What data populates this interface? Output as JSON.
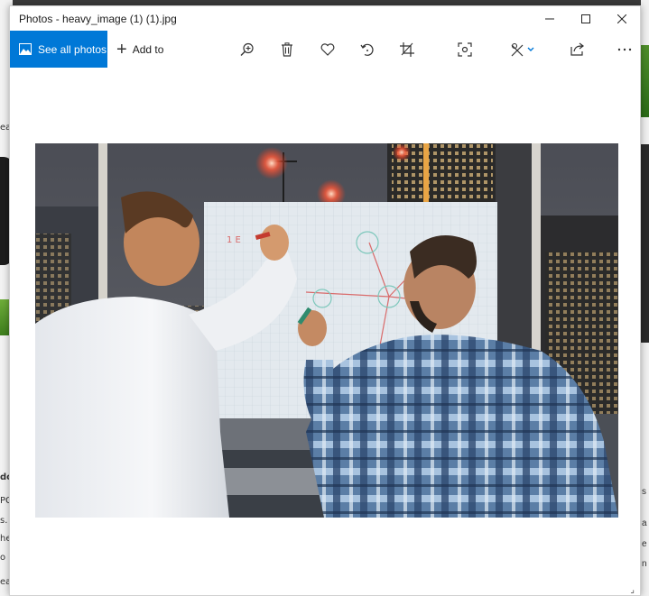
{
  "window": {
    "title": "Photos - heavy_image (1) (1).jpg",
    "controls": [
      "minimize",
      "maximize",
      "close"
    ]
  },
  "toolbar": {
    "see_all_label": "See all photos",
    "add_to_label": "Add to",
    "tools": [
      "zoom-in-icon",
      "delete-icon",
      "favorite-icon",
      "rotate-icon",
      "crop-icon",
      "enhance-icon",
      "edit-icon",
      "share-icon",
      "more-icon"
    ]
  },
  "background": {
    "left_texts": [
      "ea",
      "do",
      "PG",
      "s.",
      "he",
      "o",
      "ea"
    ],
    "right_texts": [
      "s",
      "a",
      "e",
      "n"
    ]
  },
  "colors": {
    "accent": "#0078d7"
  }
}
